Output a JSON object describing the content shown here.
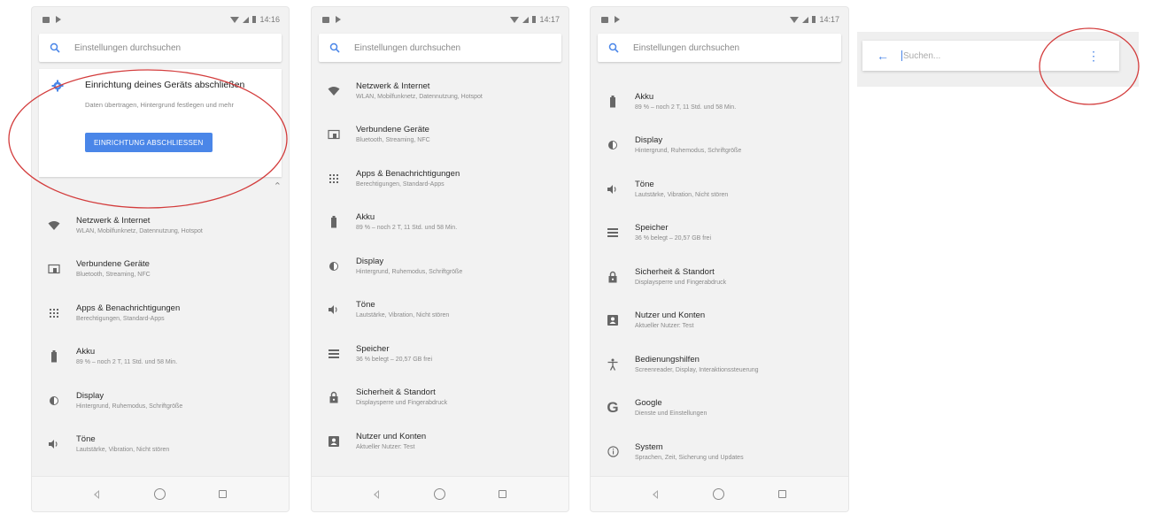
{
  "colors": {
    "accent": "#4a86e8",
    "annotation": "#d33c3c"
  },
  "statusbar": {
    "times": [
      "14:16",
      "14:17",
      "14:17"
    ]
  },
  "search": {
    "placeholder": "Einstellungen durchsuchen"
  },
  "suggestion_card": {
    "title": "Einrichtung deines Geräts abschließen",
    "body": "Daten übertragen, Hintergrund festlegen und mehr",
    "button": "EINRICHTUNG ABSCHLIESSEN"
  },
  "screen1": {
    "items": [
      {
        "icon": "wifi-icon",
        "title": "Netzwerk & Internet",
        "sub": "WLAN, Mobilfunknetz, Datennutzung, Hotspot"
      },
      {
        "icon": "devices-icon",
        "title": "Verbundene Geräte",
        "sub": "Bluetooth, Streaming, NFC"
      },
      {
        "icon": "apps-icon",
        "title": "Apps & Benachrichtigungen",
        "sub": "Berechtigungen, Standard-Apps"
      },
      {
        "icon": "battery-icon",
        "title": "Akku",
        "sub": "89 % – noch 2 T, 11 Std. und 58 Min."
      },
      {
        "icon": "display-icon",
        "title": "Display",
        "sub": "Hintergrund, Ruhemodus, Schriftgröße"
      },
      {
        "icon": "sound-icon",
        "title": "Töne",
        "sub": "Lautstärke, Vibration, Nicht stören"
      }
    ]
  },
  "screen2": {
    "items": [
      {
        "icon": "wifi-icon",
        "title": "Netzwerk & Internet",
        "sub": "WLAN, Mobilfunknetz, Datennutzung, Hotspot"
      },
      {
        "icon": "devices-icon",
        "title": "Verbundene Geräte",
        "sub": "Bluetooth, Streaming, NFC"
      },
      {
        "icon": "apps-icon",
        "title": "Apps & Benachrichtigungen",
        "sub": "Berechtigungen, Standard-Apps"
      },
      {
        "icon": "battery-icon",
        "title": "Akku",
        "sub": "89 % – noch 2 T, 11 Std. und 58 Min."
      },
      {
        "icon": "display-icon",
        "title": "Display",
        "sub": "Hintergrund, Ruhemodus, Schriftgröße"
      },
      {
        "icon": "sound-icon",
        "title": "Töne",
        "sub": "Lautstärke, Vibration, Nicht stören"
      },
      {
        "icon": "storage-icon",
        "title": "Speicher",
        "sub": "36 % belegt – 20,57 GB frei"
      },
      {
        "icon": "lock-icon",
        "title": "Sicherheit & Standort",
        "sub": "Displaysperre und Fingerabdruck"
      },
      {
        "icon": "account-icon",
        "title": "Nutzer und Konten",
        "sub": "Aktueller Nutzer: Test"
      }
    ]
  },
  "screen3": {
    "items": [
      {
        "icon": "battery-icon",
        "title": "Akku",
        "sub": "89 % – noch 2 T, 11 Std. und 58 Min."
      },
      {
        "icon": "display-icon",
        "title": "Display",
        "sub": "Hintergrund, Ruhemodus, Schriftgröße"
      },
      {
        "icon": "sound-icon",
        "title": "Töne",
        "sub": "Lautstärke, Vibration, Nicht stören"
      },
      {
        "icon": "storage-icon",
        "title": "Speicher",
        "sub": "36 % belegt – 20,57 GB frei"
      },
      {
        "icon": "lock-icon",
        "title": "Sicherheit & Standort",
        "sub": "Displaysperre und Fingerabdruck"
      },
      {
        "icon": "account-icon",
        "title": "Nutzer und Konten",
        "sub": "Aktueller Nutzer: Test"
      },
      {
        "icon": "accessibility-icon",
        "title": "Bedienungshilfen",
        "sub": "Screenreader, Display, Interaktionssteuerung"
      },
      {
        "icon": "google-icon",
        "title": "Google",
        "sub": "Dienste und Einstellungen"
      },
      {
        "icon": "info-icon",
        "title": "System",
        "sub": "Sprachen, Zeit, Sicherung und Updates"
      }
    ]
  },
  "search_screen": {
    "placeholder": "Suchen..."
  }
}
